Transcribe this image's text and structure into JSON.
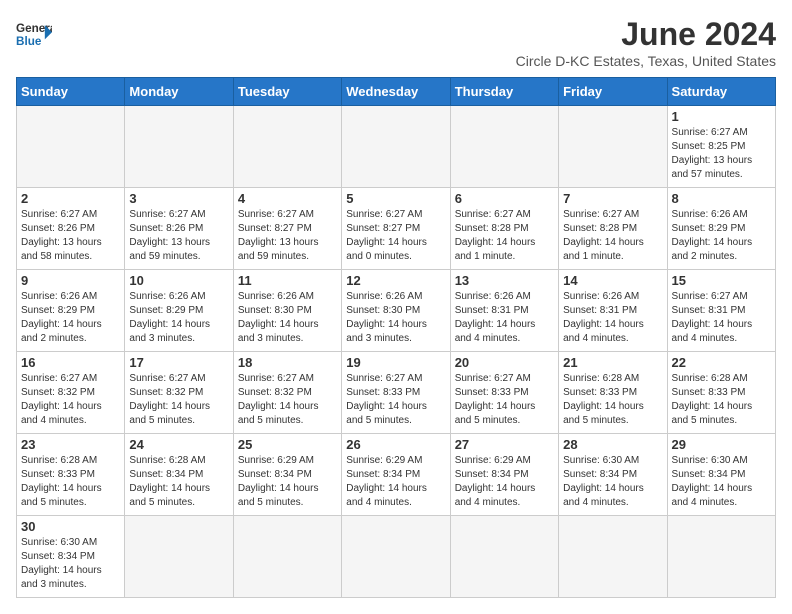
{
  "header": {
    "logo_general": "General",
    "logo_blue": "Blue",
    "month_title": "June 2024",
    "subtitle": "Circle D-KC Estates, Texas, United States"
  },
  "days_of_week": [
    "Sunday",
    "Monday",
    "Tuesday",
    "Wednesday",
    "Thursday",
    "Friday",
    "Saturday"
  ],
  "weeks": [
    [
      {
        "day": "",
        "info": ""
      },
      {
        "day": "",
        "info": ""
      },
      {
        "day": "",
        "info": ""
      },
      {
        "day": "",
        "info": ""
      },
      {
        "day": "",
        "info": ""
      },
      {
        "day": "",
        "info": ""
      },
      {
        "day": "1",
        "info": "Sunrise: 6:27 AM\nSunset: 8:25 PM\nDaylight: 13 hours\nand 57 minutes."
      }
    ],
    [
      {
        "day": "2",
        "info": "Sunrise: 6:27 AM\nSunset: 8:26 PM\nDaylight: 13 hours\nand 58 minutes."
      },
      {
        "day": "3",
        "info": "Sunrise: 6:27 AM\nSunset: 8:26 PM\nDaylight: 13 hours\nand 59 minutes."
      },
      {
        "day": "4",
        "info": "Sunrise: 6:27 AM\nSunset: 8:27 PM\nDaylight: 13 hours\nand 59 minutes."
      },
      {
        "day": "5",
        "info": "Sunrise: 6:27 AM\nSunset: 8:27 PM\nDaylight: 14 hours\nand 0 minutes."
      },
      {
        "day": "6",
        "info": "Sunrise: 6:27 AM\nSunset: 8:28 PM\nDaylight: 14 hours\nand 1 minute."
      },
      {
        "day": "7",
        "info": "Sunrise: 6:27 AM\nSunset: 8:28 PM\nDaylight: 14 hours\nand 1 minute."
      },
      {
        "day": "8",
        "info": "Sunrise: 6:26 AM\nSunset: 8:29 PM\nDaylight: 14 hours\nand 2 minutes."
      }
    ],
    [
      {
        "day": "9",
        "info": "Sunrise: 6:26 AM\nSunset: 8:29 PM\nDaylight: 14 hours\nand 2 minutes."
      },
      {
        "day": "10",
        "info": "Sunrise: 6:26 AM\nSunset: 8:29 PM\nDaylight: 14 hours\nand 3 minutes."
      },
      {
        "day": "11",
        "info": "Sunrise: 6:26 AM\nSunset: 8:30 PM\nDaylight: 14 hours\nand 3 minutes."
      },
      {
        "day": "12",
        "info": "Sunrise: 6:26 AM\nSunset: 8:30 PM\nDaylight: 14 hours\nand 3 minutes."
      },
      {
        "day": "13",
        "info": "Sunrise: 6:26 AM\nSunset: 8:31 PM\nDaylight: 14 hours\nand 4 minutes."
      },
      {
        "day": "14",
        "info": "Sunrise: 6:26 AM\nSunset: 8:31 PM\nDaylight: 14 hours\nand 4 minutes."
      },
      {
        "day": "15",
        "info": "Sunrise: 6:27 AM\nSunset: 8:31 PM\nDaylight: 14 hours\nand 4 minutes."
      }
    ],
    [
      {
        "day": "16",
        "info": "Sunrise: 6:27 AM\nSunset: 8:32 PM\nDaylight: 14 hours\nand 4 minutes."
      },
      {
        "day": "17",
        "info": "Sunrise: 6:27 AM\nSunset: 8:32 PM\nDaylight: 14 hours\nand 5 minutes."
      },
      {
        "day": "18",
        "info": "Sunrise: 6:27 AM\nSunset: 8:32 PM\nDaylight: 14 hours\nand 5 minutes."
      },
      {
        "day": "19",
        "info": "Sunrise: 6:27 AM\nSunset: 8:33 PM\nDaylight: 14 hours\nand 5 minutes."
      },
      {
        "day": "20",
        "info": "Sunrise: 6:27 AM\nSunset: 8:33 PM\nDaylight: 14 hours\nand 5 minutes."
      },
      {
        "day": "21",
        "info": "Sunrise: 6:28 AM\nSunset: 8:33 PM\nDaylight: 14 hours\nand 5 minutes."
      },
      {
        "day": "22",
        "info": "Sunrise: 6:28 AM\nSunset: 8:33 PM\nDaylight: 14 hours\nand 5 minutes."
      }
    ],
    [
      {
        "day": "23",
        "info": "Sunrise: 6:28 AM\nSunset: 8:33 PM\nDaylight: 14 hours\nand 5 minutes."
      },
      {
        "day": "24",
        "info": "Sunrise: 6:28 AM\nSunset: 8:34 PM\nDaylight: 14 hours\nand 5 minutes."
      },
      {
        "day": "25",
        "info": "Sunrise: 6:29 AM\nSunset: 8:34 PM\nDaylight: 14 hours\nand 5 minutes."
      },
      {
        "day": "26",
        "info": "Sunrise: 6:29 AM\nSunset: 8:34 PM\nDaylight: 14 hours\nand 4 minutes."
      },
      {
        "day": "27",
        "info": "Sunrise: 6:29 AM\nSunset: 8:34 PM\nDaylight: 14 hours\nand 4 minutes."
      },
      {
        "day": "28",
        "info": "Sunrise: 6:30 AM\nSunset: 8:34 PM\nDaylight: 14 hours\nand 4 minutes."
      },
      {
        "day": "29",
        "info": "Sunrise: 6:30 AM\nSunset: 8:34 PM\nDaylight: 14 hours\nand 4 minutes."
      }
    ],
    [
      {
        "day": "30",
        "info": "Sunrise: 6:30 AM\nSunset: 8:34 PM\nDaylight: 14 hours\nand 3 minutes."
      },
      {
        "day": "",
        "info": ""
      },
      {
        "day": "",
        "info": ""
      },
      {
        "day": "",
        "info": ""
      },
      {
        "day": "",
        "info": ""
      },
      {
        "day": "",
        "info": ""
      },
      {
        "day": "",
        "info": ""
      }
    ]
  ]
}
